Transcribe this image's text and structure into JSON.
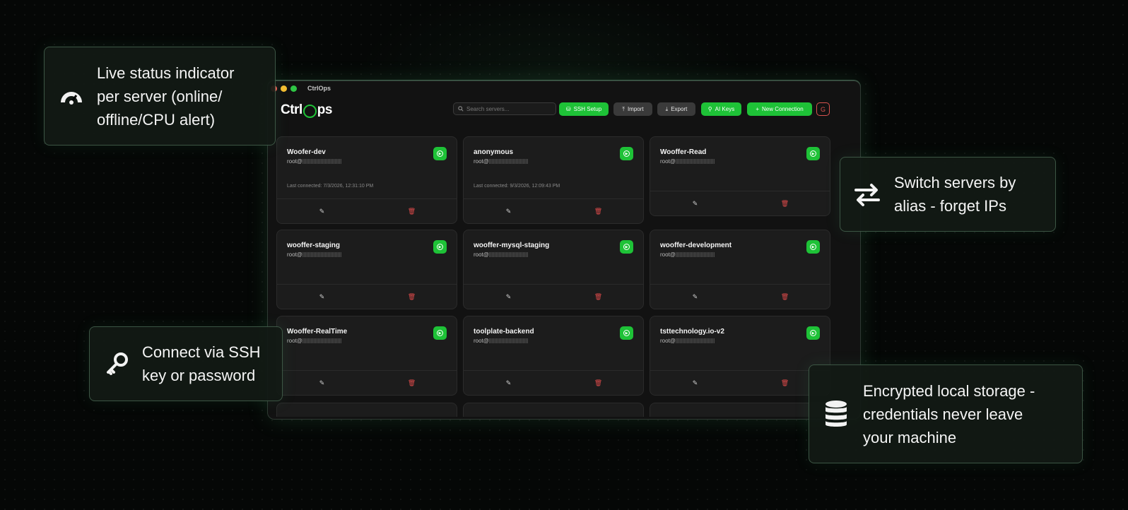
{
  "app": {
    "window_title": "CtrlOps",
    "logo_prefix": "Ctrl",
    "logo_suffix": "ps"
  },
  "search": {
    "placeholder": "Search servers..."
  },
  "toolbar": {
    "ssh_setup": "SSH Setup",
    "import": "Import",
    "export": "Export",
    "ai_keys": "AI Keys",
    "new_connection": "New Connection",
    "user_initial": "G"
  },
  "servers": [
    {
      "name": "Woofer-dev",
      "host": "root@",
      "last_connected": "Last connected: 7/3/2026, 12:31:10 PM"
    },
    {
      "name": "anonymous",
      "host": "root@",
      "last_connected": "Last connected: 9/3/2026, 12:09:43 PM"
    },
    {
      "name": "Wooffer-Read",
      "host": "root@",
      "last_connected": ""
    },
    {
      "name": "wooffer-staging",
      "host": "root@",
      "last_connected": ""
    },
    {
      "name": "wooffer-mysql-staging",
      "host": "root@",
      "last_connected": ""
    },
    {
      "name": "wooffer-development",
      "host": "root@",
      "last_connected": ""
    },
    {
      "name": "Wooffer-RealTime",
      "host": "root@",
      "last_connected": ""
    },
    {
      "name": "toolplate-backend",
      "host": "root@",
      "last_connected": ""
    },
    {
      "name": "tsttechnology.io-v2",
      "host": "root@",
      "last_connected": ""
    }
  ],
  "features": {
    "live_status": {
      "line1": "Live status indicator",
      "line2": "per server (online/",
      "line3": "offline/CPU alert)",
      "icon": "gauge-icon"
    },
    "switch_servers": {
      "line1": "Switch servers by",
      "line2": "alias - forget IPs",
      "icon": "swap-arrows-icon"
    },
    "connect_ssh": {
      "line1": "Connect via SSH",
      "line2": "key or password",
      "icon": "key-icon"
    },
    "encrypted": {
      "line1": "Encrypted local storage -",
      "line2": "credentials never leave",
      "line3": "your machine",
      "icon": "database-icon"
    }
  },
  "colors": {
    "accent_green": "#1ec237",
    "danger_red": "#e04b4b",
    "background": "#050706"
  }
}
